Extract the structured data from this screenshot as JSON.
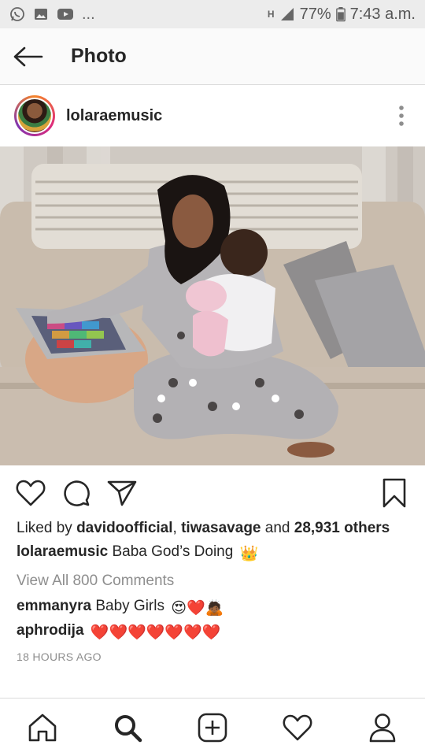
{
  "status_bar": {
    "notification_icons": [
      "whatsapp-icon",
      "gallery-icon",
      "youtube-icon"
    ],
    "more": "...",
    "network": "H",
    "battery": "77%",
    "time": "7:43 a.m."
  },
  "header": {
    "title": "Photo"
  },
  "post": {
    "username": "lolaraemusic",
    "likes": {
      "prefix": "Liked by",
      "user1": "davidoofficial",
      "user2": "tiwasavage",
      "and": "and",
      "others": "28,931 others"
    },
    "caption": {
      "username": "lolaraemusic",
      "text": "Baba God’s Doing",
      "emoji": "👑"
    },
    "view_all_comments": "View All 800 Comments",
    "comments": [
      {
        "username": "emmanyra",
        "text": "Baby Girls",
        "emoji": "😍❤️🙇🏾"
      },
      {
        "username": "aphrodija",
        "text": "",
        "emoji": "❤️❤️❤️❤️❤️❤️❤️"
      }
    ],
    "timestamp": "18 HOURS AGO"
  },
  "colors": {
    "text": "#262626",
    "secondary_text": "#8e8e8e",
    "heart_red": "#e8233c",
    "status_bar_bg": "#ececec"
  },
  "bottom_nav": [
    "home-icon",
    "search-icon",
    "add-post-icon",
    "activity-heart-icon",
    "profile-icon"
  ]
}
